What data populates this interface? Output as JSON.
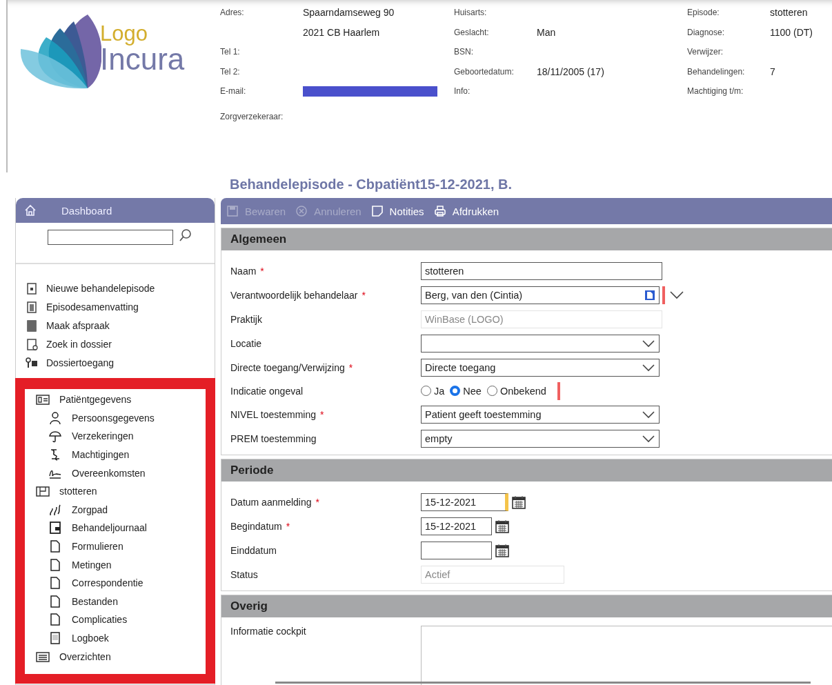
{
  "logo": {
    "line1": "Logo",
    "line2": "Incura"
  },
  "patient_info": [
    [
      {
        "label": "Adres:",
        "value": "Spaarndamseweg 90"
      },
      {
        "value": "2021 CB Haarlem"
      },
      {
        "label": "Tel 1:"
      },
      {
        "label": "Tel 2:"
      },
      {
        "label": "E-mail:",
        "redacted": true
      },
      {
        "label": "Zorgverzekeraar:"
      }
    ],
    [
      {
        "label": "Huisarts:"
      },
      {
        "label": "Geslacht:",
        "value": "Man"
      },
      {
        "label": "BSN:"
      },
      {
        "label": "Geboortedatum:",
        "value": "18/11/2005 (17)"
      },
      {
        "label": "Info:"
      }
    ],
    [
      {
        "label": "Episode:",
        "value": "stotteren"
      },
      {
        "label": "Diagnose:",
        "value": "1100 (DT)"
      },
      {
        "label": "Verwijzer:"
      },
      {
        "label": "Behandelingen:",
        "value": "7"
      },
      {
        "label": "Machtiging t/m:"
      }
    ]
  ],
  "title": "Behandelepisode - Cbpatiënt15-12-2021, B.",
  "sidebar": {
    "header": "Dashboard",
    "actions": [
      "Nieuwe behandelepisode",
      "Episodesamenvatting",
      "Maak afspraak",
      "Zoek in dossier",
      "Dossiertoegang"
    ],
    "tree": [
      {
        "label": "Patiëntgegevens",
        "children": [
          {
            "label": "Persoonsgegevens"
          },
          {
            "label": "Verzekeringen"
          },
          {
            "label": "Machtigingen"
          },
          {
            "label": "Overeenkomsten"
          }
        ]
      },
      {
        "label": "stotteren",
        "children": [
          {
            "label": "Zorgpad"
          },
          {
            "label": "Behandeljournaal"
          },
          {
            "label": "Formulieren"
          },
          {
            "label": "Metingen"
          },
          {
            "label": "Correspondentie"
          },
          {
            "label": "Bestanden"
          },
          {
            "label": "Complicaties"
          },
          {
            "label": "Logboek"
          }
        ]
      },
      {
        "label": "Overzichten"
      }
    ]
  },
  "toolbar": [
    {
      "label": "Bewaren",
      "disabled": true
    },
    {
      "label": "Annuleren",
      "disabled": true
    },
    {
      "label": "Notities",
      "disabled": false
    },
    {
      "label": "Afdrukken",
      "disabled": false
    }
  ],
  "sections": [
    {
      "title": "Algemeen",
      "fields": [
        {
          "kind": "text",
          "label": "Naam",
          "mark": "*",
          "value": "stotteren"
        },
        {
          "kind": "lookup",
          "label": "Verantwoordelijk behandelaar",
          "mark": "*",
          "value": "Berg, van den (Cintia)",
          "flagged": true
        },
        {
          "kind": "readonly",
          "label": "Praktijk",
          "value": "WinBase (LOGO)"
        },
        {
          "kind": "select",
          "label": "Locatie"
        },
        {
          "kind": "select",
          "label": "Directe toegang/Verwijzing",
          "mark": "*",
          "value": "Directe toegang"
        },
        {
          "kind": "radio",
          "label": "Indicatie ongeval",
          "flagged": true,
          "options": [
            {
              "label": "Ja",
              "selected": false
            },
            {
              "label": "Nee",
              "selected": true
            },
            {
              "label": "Onbekend",
              "selected": false
            }
          ]
        },
        {
          "kind": "select",
          "label": "NIVEL toestemming",
          "mark": "*",
          "value": "Patient geeft toestemming"
        },
        {
          "kind": "select",
          "label": "PREM toestemming",
          "value": "empty"
        }
      ]
    },
    {
      "title": "Periode",
      "fields": [
        {
          "kind": "date",
          "label": "Datum aanmelding",
          "mark": "*",
          "value": "15-12-2021",
          "focused": true
        },
        {
          "kind": "date",
          "label": "Begindatum",
          "mark": "*",
          "value": "15-12-2021",
          "focused": false
        },
        {
          "kind": "date",
          "label": "Einddatum",
          "focused": false
        },
        {
          "kind": "readonly-short",
          "label": "Status",
          "value": "Actief"
        }
      ]
    },
    {
      "title": "Overig",
      "fields": [
        {
          "kind": "textarea",
          "label": "Informatie cockpit"
        }
      ]
    }
  ]
}
